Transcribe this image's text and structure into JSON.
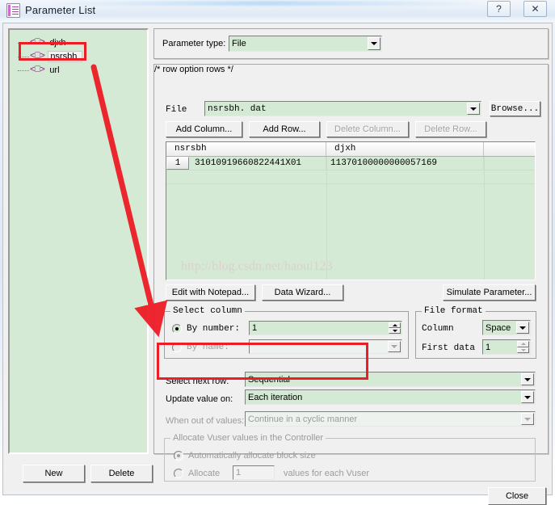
{
  "window": {
    "title": "Parameter List",
    "icon": "document-icon",
    "help_button": "?",
    "close_button": "✕"
  },
  "tree": {
    "items": [
      {
        "label": "djxh",
        "glyph": "<⎕>",
        "selected": false
      },
      {
        "label": "nsrsbh",
        "glyph": "<⎕>",
        "selected": true
      },
      {
        "label": "url",
        "glyph": "<⎕>",
        "selected": false
      }
    ]
  },
  "parameter_type": {
    "label": "Parameter type:",
    "value": "File"
  },
  "file_section": {
    "file_label": "File",
    "file_value": "nsrsbh. dat",
    "browse_button": "Browse...",
    "buttons": [
      {
        "label": "Add Column...",
        "enabled": true
      },
      {
        "label": "Add Row...",
        "enabled": true
      },
      {
        "label": "Delete Column...",
        "enabled": false
      },
      {
        "label": "Delete Row...",
        "enabled": false
      }
    ],
    "grid": {
      "columns": [
        "nsrsbh",
        "djxh",
        ""
      ],
      "rows": [
        {
          "number": "1",
          "cells": [
            "31010919660822441X01",
            "11370100000000057169",
            ""
          ]
        }
      ]
    },
    "watermark": "http://blog.csdn.net/haoui123",
    "bottom_buttons": [
      {
        "label": "Edit with Notepad...",
        "enabled": true
      },
      {
        "label": "Data Wizard...",
        "enabled": true
      },
      {
        "label": "Simulate Parameter...",
        "enabled": true
      }
    ]
  },
  "select_column": {
    "title": "Select column",
    "by_number_label": "By number:",
    "by_number_value": "1",
    "by_number_selected": true,
    "by_name_label": "By name:",
    "by_name_value": "",
    "by_name_selected": false
  },
  "file_format": {
    "title": "File format",
    "column_label": "Column",
    "column_value": "Space",
    "first_data_label": "First data",
    "first_data_value": "1"
  },
  "row_options": {
    "select_next_row_label": "Select next row:",
    "select_next_row_value": "Sequential",
    "update_value_on_label": "Update value on:",
    "update_value_on_value": "Each iteration",
    "when_out_of_values_label": "When out of values:",
    "when_out_of_values_value": "Continue in a cyclic manner"
  },
  "allocate": {
    "title": "Allocate Vuser values in the Controller",
    "auto_label": "Automatically allocate block size",
    "auto_selected": true,
    "allocate_label": "Allocate",
    "allocate_value": "1",
    "allocate_suffix": "values for each Vuser"
  },
  "footer": {
    "new_button": "New",
    "delete_button": "Delete",
    "close_button": "Close"
  },
  "annotation": {
    "highlight_color": "#ee1c25",
    "arrow": "red-arrow-pointing-to-row-options"
  }
}
